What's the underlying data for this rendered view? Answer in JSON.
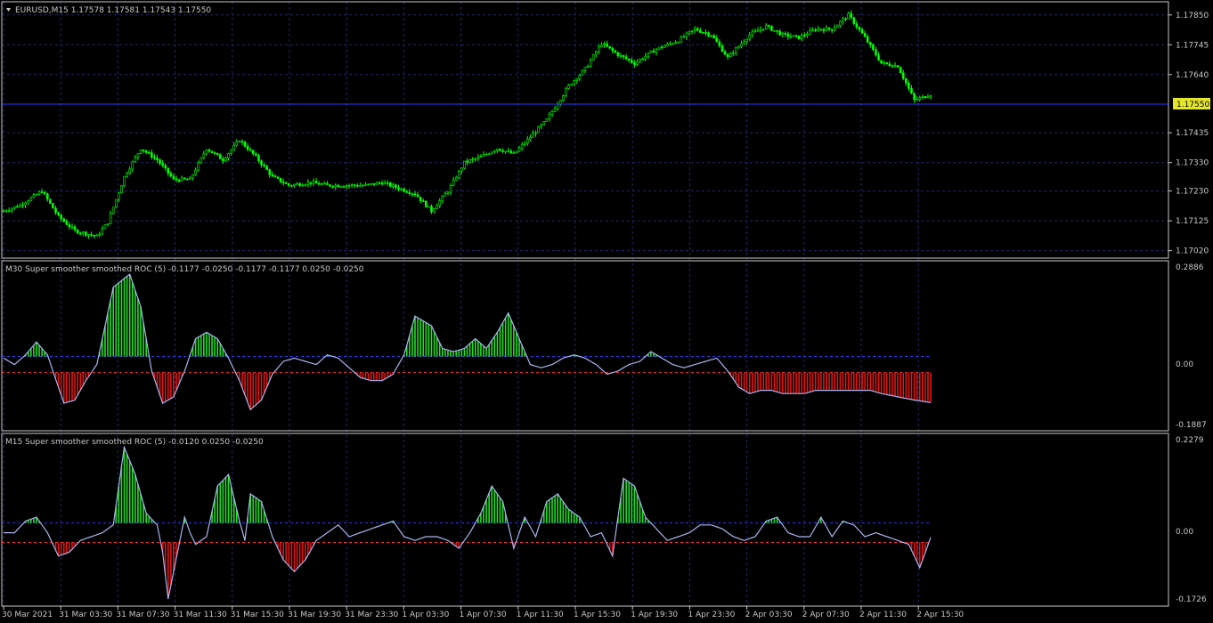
{
  "colors": {
    "background": "#000000",
    "grid": "#1e2a66",
    "frame": "#c8c8c8",
    "candle": "#00ff00",
    "bid_line": "#2a3cff",
    "price_badge_bg": "#e4e62a",
    "hist_up": "#22e022",
    "hist_down": "#e01616",
    "smooth_line": "#aab4f0",
    "level_blue": "#2a3cff",
    "level_red": "#ff3030"
  },
  "price_chart": {
    "symbol_arrow_icon": "triangle-down-icon",
    "header": "EURUSD,M15  1.17578 1.17581 1.17543 1.17550",
    "current_price_badge": "1.17550",
    "y_ticks": [
      "1.17850",
      "1.17745",
      "1.17640",
      "1.17435",
      "1.17330",
      "1.17230",
      "1.17125",
      "1.17020"
    ]
  },
  "indicator_m30": {
    "header": "M30 Super smoother smoothed ROC (5) -0.1177 -0.0250 -0.1177 -0.1177 0.0250 -0.0250",
    "y_ticks": [
      "0.2886",
      "0.00",
      "-0.1887"
    ]
  },
  "indicator_m15": {
    "header": "M15 Super smoother smoothed ROC (5) -0.0120 0.0250 -0.0250",
    "y_ticks": [
      "0.2279",
      "0.00",
      "-0.1726"
    ]
  },
  "time_axis": {
    "labels": [
      "30 Mar 2021",
      "31 Mar 03:30",
      "31 Mar 07:30",
      "31 Mar 11:30",
      "31 Mar 15:30",
      "31 Mar 19:30",
      "31 Mar 23:30",
      "1 Apr 03:30",
      "1 Apr 07:30",
      "1 Apr 11:30",
      "1 Apr 15:30",
      "1 Apr 19:30",
      "1 Apr 23:30",
      "2 Apr 03:30",
      "2 Apr 07:30",
      "2 Apr 11:30",
      "2 Apr 15:30"
    ]
  },
  "chart_data": [
    {
      "type": "candlestick",
      "title": "EURUSD,M15",
      "ylim": [
        1.17,
        1.1789
      ],
      "close_anchors": [
        [
          0,
          1.1716
        ],
        [
          6,
          1.1718
        ],
        [
          14,
          1.1723
        ],
        [
          20,
          1.1714
        ],
        [
          26,
          1.1709
        ],
        [
          34,
          1.1707
        ],
        [
          38,
          1.1712
        ],
        [
          44,
          1.1728
        ],
        [
          50,
          1.1738
        ],
        [
          56,
          1.1734
        ],
        [
          62,
          1.1727
        ],
        [
          68,
          1.1727
        ],
        [
          74,
          1.1738
        ],
        [
          80,
          1.1734
        ],
        [
          86,
          1.1741
        ],
        [
          92,
          1.1735
        ],
        [
          98,
          1.1728
        ],
        [
          104,
          1.1725
        ],
        [
          112,
          1.1726
        ],
        [
          118,
          1.1725
        ],
        [
          126,
          1.1725
        ],
        [
          132,
          1.1725
        ],
        [
          138,
          1.1726
        ],
        [
          144,
          1.1724
        ],
        [
          150,
          1.1722
        ],
        [
          156,
          1.1716
        ],
        [
          162,
          1.1723
        ],
        [
          168,
          1.1733
        ],
        [
          174,
          1.1735
        ],
        [
          180,
          1.1738
        ],
        [
          186,
          1.1736
        ],
        [
          192,
          1.1742
        ],
        [
          198,
          1.1748
        ],
        [
          206,
          1.176
        ],
        [
          212,
          1.1766
        ],
        [
          218,
          1.1775
        ],
        [
          224,
          1.1771
        ],
        [
          230,
          1.1768
        ],
        [
          238,
          1.1773
        ],
        [
          246,
          1.1776
        ],
        [
          252,
          1.178
        ],
        [
          258,
          1.1778
        ],
        [
          264,
          1.177
        ],
        [
          272,
          1.1778
        ],
        [
          278,
          1.1781
        ],
        [
          284,
          1.1778
        ],
        [
          290,
          1.1777
        ],
        [
          296,
          1.178
        ],
        [
          302,
          1.178
        ],
        [
          308,
          1.1785
        ],
        [
          314,
          1.1777
        ],
        [
          320,
          1.1768
        ],
        [
          326,
          1.1767
        ],
        [
          332,
          1.1755
        ],
        [
          338,
          1.1757
        ]
      ]
    },
    {
      "type": "histogram",
      "title": "M30 Super smoother smoothed ROC (5)",
      "ylim": [
        -0.1887,
        0.2886
      ],
      "levels": [
        0.025,
        -0.025
      ],
      "anchors": [
        [
          0,
          0.02
        ],
        [
          4,
          0.0
        ],
        [
          8,
          0.03
        ],
        [
          12,
          0.07
        ],
        [
          16,
          0.03
        ],
        [
          22,
          -0.12
        ],
        [
          26,
          -0.11
        ],
        [
          30,
          -0.05
        ],
        [
          34,
          0.0
        ],
        [
          40,
          0.24
        ],
        [
          46,
          0.28
        ],
        [
          50,
          0.18
        ],
        [
          54,
          -0.02
        ],
        [
          58,
          -0.12
        ],
        [
          62,
          -0.1
        ],
        [
          66,
          -0.02
        ],
        [
          70,
          0.08
        ],
        [
          74,
          0.1
        ],
        [
          78,
          0.08
        ],
        [
          82,
          0.02
        ],
        [
          86,
          -0.05
        ],
        [
          90,
          -0.14
        ],
        [
          94,
          -0.11
        ],
        [
          98,
          -0.03
        ],
        [
          102,
          0.01
        ],
        [
          106,
          0.02
        ],
        [
          110,
          0.01
        ],
        [
          114,
          0.0
        ],
        [
          118,
          0.03
        ],
        [
          122,
          0.02
        ],
        [
          126,
          -0.01
        ],
        [
          130,
          -0.04
        ],
        [
          134,
          -0.05
        ],
        [
          138,
          -0.05
        ],
        [
          142,
          -0.03
        ],
        [
          146,
          0.03
        ],
        [
          150,
          0.15
        ],
        [
          156,
          0.12
        ],
        [
          160,
          0.05
        ],
        [
          164,
          0.04
        ],
        [
          168,
          0.05
        ],
        [
          172,
          0.08
        ],
        [
          176,
          0.05
        ],
        [
          180,
          0.1
        ],
        [
          184,
          0.16
        ],
        [
          188,
          0.08
        ],
        [
          192,
          0.0
        ],
        [
          196,
          -0.01
        ],
        [
          200,
          0.0
        ],
        [
          204,
          0.02
        ],
        [
          208,
          0.03
        ],
        [
          212,
          0.02
        ],
        [
          216,
          0.0
        ],
        [
          220,
          -0.03
        ],
        [
          224,
          -0.02
        ],
        [
          228,
          0.0
        ],
        [
          232,
          0.01
        ],
        [
          236,
          0.04
        ],
        [
          240,
          0.02
        ],
        [
          244,
          0.0
        ],
        [
          248,
          -0.01
        ],
        [
          252,
          0.0
        ],
        [
          256,
          0.01
        ],
        [
          260,
          0.02
        ],
        [
          264,
          -0.02
        ],
        [
          268,
          -0.07
        ],
        [
          272,
          -0.09
        ],
        [
          276,
          -0.08
        ],
        [
          280,
          -0.08
        ],
        [
          284,
          -0.09
        ],
        [
          288,
          -0.09
        ],
        [
          292,
          -0.09
        ],
        [
          296,
          -0.08
        ],
        [
          300,
          -0.08
        ],
        [
          304,
          -0.08
        ],
        [
          310,
          -0.08
        ],
        [
          316,
          -0.08
        ],
        [
          320,
          -0.09
        ],
        [
          326,
          -0.1
        ],
        [
          332,
          -0.11
        ],
        [
          338,
          -0.118
        ]
      ]
    },
    {
      "type": "histogram",
      "title": "M15 Super smoother smoothed ROC (5)",
      "ylim": [
        -0.1726,
        0.2279
      ],
      "levels": [
        0.025,
        -0.025
      ],
      "anchors": [
        [
          0,
          0.0
        ],
        [
          4,
          0.0
        ],
        [
          8,
          0.03
        ],
        [
          12,
          0.04
        ],
        [
          16,
          0.0
        ],
        [
          20,
          -0.06
        ],
        [
          24,
          -0.05
        ],
        [
          28,
          -0.02
        ],
        [
          32,
          -0.01
        ],
        [
          36,
          0.0
        ],
        [
          40,
          0.02
        ],
        [
          44,
          0.22
        ],
        [
          48,
          0.15
        ],
        [
          52,
          0.05
        ],
        [
          56,
          0.02
        ],
        [
          58,
          -0.05
        ],
        [
          60,
          -0.17
        ],
        [
          64,
          -0.03
        ],
        [
          66,
          0.04
        ],
        [
          68,
          0.0
        ],
        [
          70,
          -0.03
        ],
        [
          74,
          -0.01
        ],
        [
          78,
          0.12
        ],
        [
          82,
          0.15
        ],
        [
          86,
          0.03
        ],
        [
          88,
          -0.02
        ],
        [
          90,
          0.1
        ],
        [
          94,
          0.08
        ],
        [
          98,
          -0.01
        ],
        [
          102,
          -0.07
        ],
        [
          106,
          -0.1
        ],
        [
          110,
          -0.07
        ],
        [
          114,
          -0.02
        ],
        [
          118,
          0.0
        ],
        [
          122,
          0.02
        ],
        [
          126,
          -0.01
        ],
        [
          130,
          0.0
        ],
        [
          134,
          0.01
        ],
        [
          138,
          0.02
        ],
        [
          142,
          0.03
        ],
        [
          146,
          -0.01
        ],
        [
          150,
          -0.02
        ],
        [
          154,
          -0.01
        ],
        [
          158,
          -0.01
        ],
        [
          162,
          -0.02
        ],
        [
          166,
          -0.04
        ],
        [
          170,
          0.0
        ],
        [
          174,
          0.05
        ],
        [
          178,
          0.12
        ],
        [
          182,
          0.08
        ],
        [
          186,
          -0.04
        ],
        [
          190,
          0.04
        ],
        [
          194,
          -0.01
        ],
        [
          198,
          0.08
        ],
        [
          202,
          0.1
        ],
        [
          206,
          0.06
        ],
        [
          210,
          0.04
        ],
        [
          214,
          -0.01
        ],
        [
          218,
          0.0
        ],
        [
          222,
          -0.06
        ],
        [
          226,
          0.14
        ],
        [
          230,
          0.12
        ],
        [
          234,
          0.04
        ],
        [
          238,
          0.01
        ],
        [
          242,
          -0.02
        ],
        [
          246,
          -0.01
        ],
        [
          250,
          0.0
        ],
        [
          254,
          0.02
        ],
        [
          258,
          0.02
        ],
        [
          262,
          0.01
        ],
        [
          266,
          -0.01
        ],
        [
          270,
          -0.02
        ],
        [
          274,
          -0.01
        ],
        [
          278,
          0.03
        ],
        [
          282,
          0.04
        ],
        [
          286,
          0.0
        ],
        [
          290,
          -0.01
        ],
        [
          294,
          -0.01
        ],
        [
          298,
          0.04
        ],
        [
          302,
          -0.01
        ],
        [
          306,
          0.03
        ],
        [
          310,
          0.02
        ],
        [
          314,
          -0.01
        ],
        [
          318,
          0.0
        ],
        [
          322,
          -0.01
        ],
        [
          326,
          -0.02
        ],
        [
          330,
          -0.03
        ],
        [
          334,
          -0.09
        ],
        [
          338,
          -0.012
        ]
      ]
    }
  ]
}
